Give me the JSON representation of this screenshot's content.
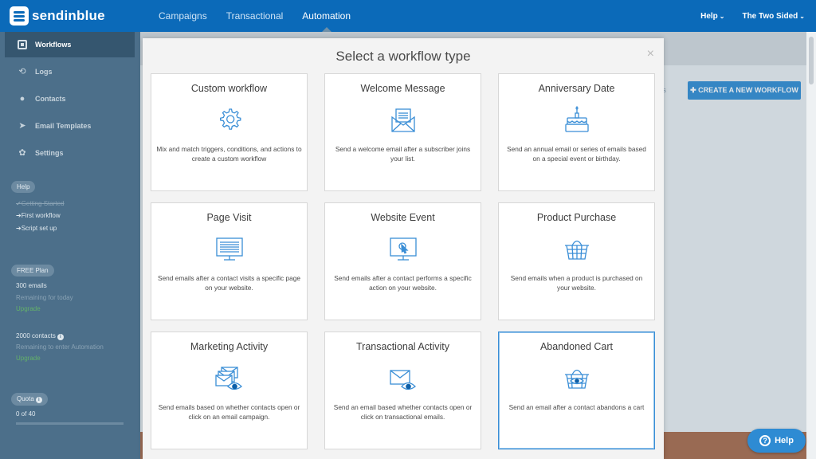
{
  "brand": {
    "name": "sendinblue"
  },
  "nav": {
    "items": [
      "Campaigns",
      "Transactional",
      "Automation"
    ],
    "active": "Automation"
  },
  "top_right": {
    "help": "Help",
    "account": "The Two Sided",
    "caret": "⌄"
  },
  "sidebar": {
    "items": [
      {
        "label": "Workflows",
        "icon": "workflows-icon"
      },
      {
        "label": "Logs",
        "icon": "logs-icon"
      },
      {
        "label": "Contacts",
        "icon": "contacts-icon"
      },
      {
        "label": "Email Templates",
        "icon": "email-templates-icon"
      },
      {
        "label": "Settings",
        "icon": "settings-icon"
      }
    ],
    "help_label": "Help",
    "help_links": [
      "✔Getting Started",
      "➔First workflow",
      "➔Script set up"
    ],
    "plan_label": "FREE Plan",
    "emails": "300 emails",
    "emails_note": "Remaining for today",
    "upgrade_1": "Upgrade",
    "contacts": "2000 contacts",
    "contacts_note": "Remaining to enter Automation",
    "upgrade_2": "Upgrade",
    "quota_label": "Quota",
    "quota_value": "0 of 40"
  },
  "background": {
    "samples": "mples",
    "create_button": "✚ CREATE A NEW WORKFLOW"
  },
  "modal": {
    "title": "Select a workflow type",
    "close": "×",
    "cards": [
      {
        "title": "Custom workflow",
        "desc": "Mix and match triggers, conditions, and actions to create a custom workflow",
        "icon": "gear-icon"
      },
      {
        "title": "Welcome Message",
        "desc": "Send a welcome email after a subscriber joins your list.",
        "icon": "envelope-letter-icon"
      },
      {
        "title": "Anniversary Date",
        "desc": "Send an annual email or series of emails based on a special event or birthday.",
        "icon": "birthday-cake-icon"
      },
      {
        "title": "Page Visit",
        "desc": "Send emails after a contact visits a specific page on your website.",
        "icon": "monitor-page-icon"
      },
      {
        "title": "Website Event",
        "desc": "Send emails after a contact performs a specific action on your website.",
        "icon": "monitor-cursor-icon"
      },
      {
        "title": "Product Purchase",
        "desc": "Send emails when a product is purchased on your website.",
        "icon": "shopping-basket-icon"
      },
      {
        "title": "Marketing Activity",
        "desc": "Send emails based on whether contacts open or click on an email campaign.",
        "icon": "envelopes-eye-icon"
      },
      {
        "title": "Transactional Activity",
        "desc": "Send an email based whether contacts open or click on transactional emails.",
        "icon": "envelope-eye-icon"
      },
      {
        "title": "Abandoned Cart",
        "desc": "Send an email after a contact abandons a cart",
        "icon": "basket-eye-icon"
      }
    ],
    "selected": "Abandoned Cart"
  },
  "help_widget": {
    "label": "Help"
  },
  "colors": {
    "topbar": "#0b6ab9",
    "sidebar": "#4c6f8a",
    "accent": "#2e8bd3",
    "icon_stroke": "#3a8ed6"
  }
}
